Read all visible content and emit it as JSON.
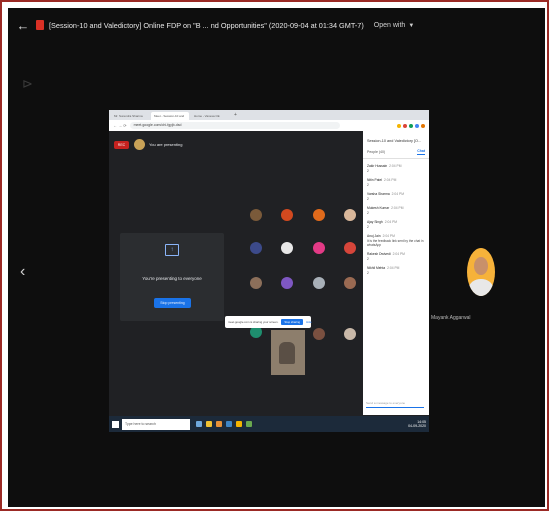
{
  "viewer": {
    "file_title": "[Session-10 and Valedictory] Online FDP on \"B ... nd Opportunities\" (2020-09-04 at 01:34 GMT-7)",
    "open_with": "Open with"
  },
  "browser": {
    "tabs": [
      "Mr. Surendra Sharma",
      "Meet - Session-10 and",
      "Home - Vanesa CE"
    ],
    "url": "meet.google.com/ohi-fgyjb-dsd"
  },
  "meet": {
    "rec_label": "REC",
    "presenting_label": "You are presenting",
    "present_message": "You're presenting to everyone",
    "stop_presenting": "Stop presenting",
    "share_bar_text": "meet.google.com is sharing your screen.",
    "share_stop": "Stop sharing",
    "share_hide": "Hide"
  },
  "chat": {
    "title": "Session-10 and Valedictory [O...",
    "people_tab": "People (40)",
    "chat_tab": "Chat",
    "messages": [
      {
        "name": "Zakir Hussain",
        "time": "2:04 PM",
        "text": "2"
      },
      {
        "name": "Nitin Patel",
        "time": "2:04 PM",
        "text": "2"
      },
      {
        "name": "Varsha Sharma",
        "time": "2:04 PM",
        "text": "2"
      },
      {
        "name": "Mukesh Kumar",
        "time": "2:04 PM",
        "text": "2"
      },
      {
        "name": "Ajay Singh",
        "time": "2:04 PM",
        "text": "2"
      },
      {
        "name": "Anuj Jain",
        "time": "2:04 PM",
        "text": "It is the feedback link sent by the chat in whatsApp"
      },
      {
        "name": "Rakesh Dwivedi",
        "time": "2:04 PM",
        "text": "2"
      },
      {
        "name": "Nikhil Mehta",
        "time": "2:04 PM",
        "text": "2"
      }
    ],
    "input_placeholder": "Send a message to everyone"
  },
  "taskbar": {
    "search_placeholder": "Type here to search",
    "time": "14:05",
    "date": "04-09-2020"
  },
  "participant": {
    "name": "Mayank Aggarwal"
  }
}
